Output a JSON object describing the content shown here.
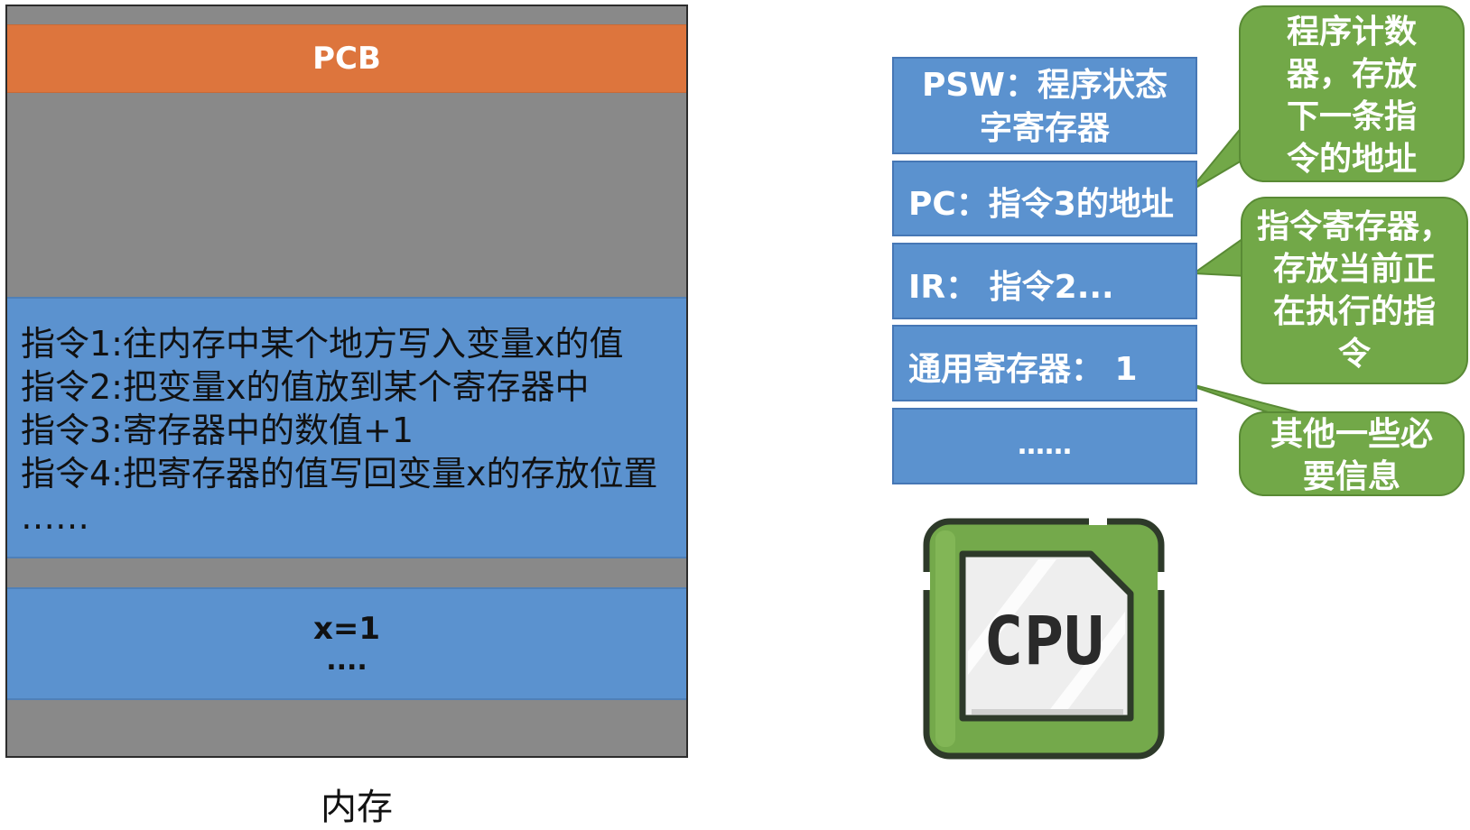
{
  "memory": {
    "pcb_label": "PCB",
    "instructions": [
      "指令1:往内存中某个地方写入变量x的值",
      "指令2:把变量x的值放到某个寄存器中",
      "指令3:寄存器中的数值+1",
      "指令4:把寄存器的值写回变量x的存放位置",
      "……"
    ],
    "data_value": "x=1",
    "data_ellipsis": "....",
    "label": "内存"
  },
  "registers": {
    "psw": [
      "PSW：程序状态",
      "字寄存器"
    ],
    "pc": "PC：指令3的地址",
    "ir": "IR：  指令2...",
    "gpr": "通用寄存器：  1",
    "more": "……"
  },
  "callouts": {
    "pc_note": [
      "程序计数",
      "器，存放",
      "下一条指",
      "令的地址"
    ],
    "ir_note": [
      "指令寄存器，",
      "存放当前正",
      "在执行的指",
      "令"
    ],
    "other_note": [
      "其他一些必",
      "要信息"
    ]
  },
  "cpu": {
    "label": "CPU",
    "icon": "cpu-chip-icon"
  },
  "colors": {
    "memory_bg": "#898989",
    "pcb": "#dd753d",
    "blue": "#5b92cf",
    "green": "#72a848"
  }
}
